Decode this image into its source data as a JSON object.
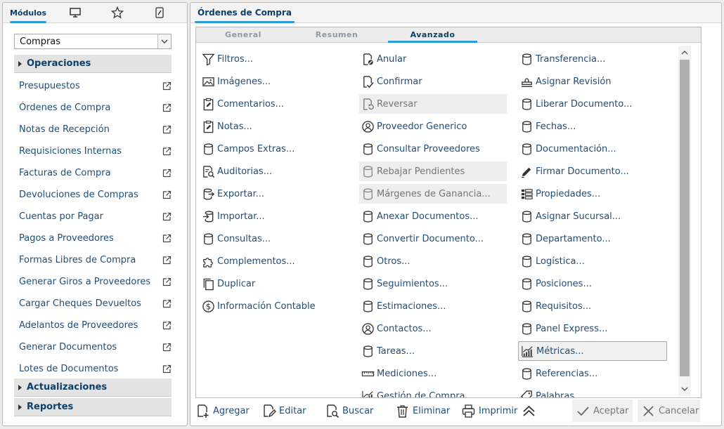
{
  "left": {
    "tabs": [
      {
        "label": "Módulos",
        "icon": "modules"
      },
      {
        "label": "",
        "icon": "monitor-icon"
      },
      {
        "label": "",
        "icon": "star-icon"
      },
      {
        "label": "",
        "icon": "wrench-icon"
      }
    ],
    "module_select": "Compras",
    "sections": {
      "operaciones": "Operaciones",
      "actualizaciones": "Actualizaciones",
      "reportes": "Reportes"
    },
    "items": [
      "Presupuestos",
      "Órdenes de Compra",
      "Notas de Recepción",
      "Requisiciones Internas",
      "Facturas de Compra",
      "Devoluciones de Compras",
      "Cuentas por Pagar",
      "Pagos a Proveedores",
      "Formas Libres de Compra",
      "Generar Giros a Proveedores",
      "Cargar Cheques Devueltos",
      "Adelantos de Proveedores",
      "Generar Documentos",
      "Lotes de Documentos"
    ]
  },
  "right": {
    "title": "Órdenes de Compra",
    "tabs": [
      "General",
      "Resumen",
      "Avanzado"
    ],
    "active_tab": "Avanzado",
    "col1": [
      {
        "label": "Filtros...",
        "icon": "filter"
      },
      {
        "label": "Imágenes...",
        "icon": "image"
      },
      {
        "label": "Comentarios...",
        "icon": "clipboard-edit"
      },
      {
        "label": "Notas...",
        "icon": "clipboard-edit"
      },
      {
        "label": "Campos Extras...",
        "icon": "db"
      },
      {
        "label": "Auditorias...",
        "icon": "audit"
      },
      {
        "label": "Exportar...",
        "icon": "db-export"
      },
      {
        "label": "Importar...",
        "icon": "db-import"
      },
      {
        "label": "Consultas...",
        "icon": "db"
      },
      {
        "label": "Complementos...",
        "icon": "puzzle"
      },
      {
        "label": "Duplicar",
        "icon": "copy"
      },
      {
        "label": "Información Contable",
        "icon": "dollar"
      }
    ],
    "col2": [
      {
        "label": "Anular",
        "icon": "doc-cancel"
      },
      {
        "label": "Confirmar",
        "icon": "doc-check"
      },
      {
        "label": "Reversar",
        "icon": "doc-undo",
        "disabled": true
      },
      {
        "label": "Proveedor Generico",
        "icon": "user"
      },
      {
        "label": "Consultar Proveedores",
        "icon": "db"
      },
      {
        "label": "Rebajar Pendientes",
        "icon": "db",
        "disabled": true
      },
      {
        "label": "Márgenes de Ganancia...",
        "icon": "db",
        "disabled": true
      },
      {
        "label": "Anexar Documentos...",
        "icon": "db"
      },
      {
        "label": "Convertir Documento...",
        "icon": "db"
      },
      {
        "label": "Otros...",
        "icon": "db"
      },
      {
        "label": "Seguimientos...",
        "icon": "db"
      },
      {
        "label": "Estimaciones...",
        "icon": "db"
      },
      {
        "label": "Contactos...",
        "icon": "user"
      },
      {
        "label": "Tareas...",
        "icon": "db"
      },
      {
        "label": "Mediciones...",
        "icon": "ruler"
      },
      {
        "label": "Gestión de Compra",
        "icon": "chart"
      }
    ],
    "col3": [
      {
        "label": "Transferencia...",
        "icon": "db"
      },
      {
        "label": "Asignar Revisión",
        "icon": "stamp"
      },
      {
        "label": "Liberar Documento...",
        "icon": "db"
      },
      {
        "label": "Fechas...",
        "icon": "db"
      },
      {
        "label": "Documentación...",
        "icon": "db"
      },
      {
        "label": "Firmar Documento...",
        "icon": "pen"
      },
      {
        "label": "Propiedades...",
        "icon": "grid"
      },
      {
        "label": "Asignar Sucursal...",
        "icon": "db"
      },
      {
        "label": "Departamento...",
        "icon": "db"
      },
      {
        "label": "Logística...",
        "icon": "db"
      },
      {
        "label": "Posiciones...",
        "icon": "db"
      },
      {
        "label": "Requisitos...",
        "icon": "db"
      },
      {
        "label": "Panel Express...",
        "icon": "db"
      },
      {
        "label": "Métricas...",
        "icon": "chart",
        "selected": true
      },
      {
        "label": "Referencias...",
        "icon": "db"
      },
      {
        "label": "Palabras",
        "icon": "tag"
      }
    ],
    "toolbar": {
      "add": "Agregar",
      "edit": "Editar",
      "search": "Buscar",
      "delete": "Eliminar",
      "print": "Imprimir",
      "accept": "Aceptar",
      "cancel": "Cancelar"
    }
  }
}
